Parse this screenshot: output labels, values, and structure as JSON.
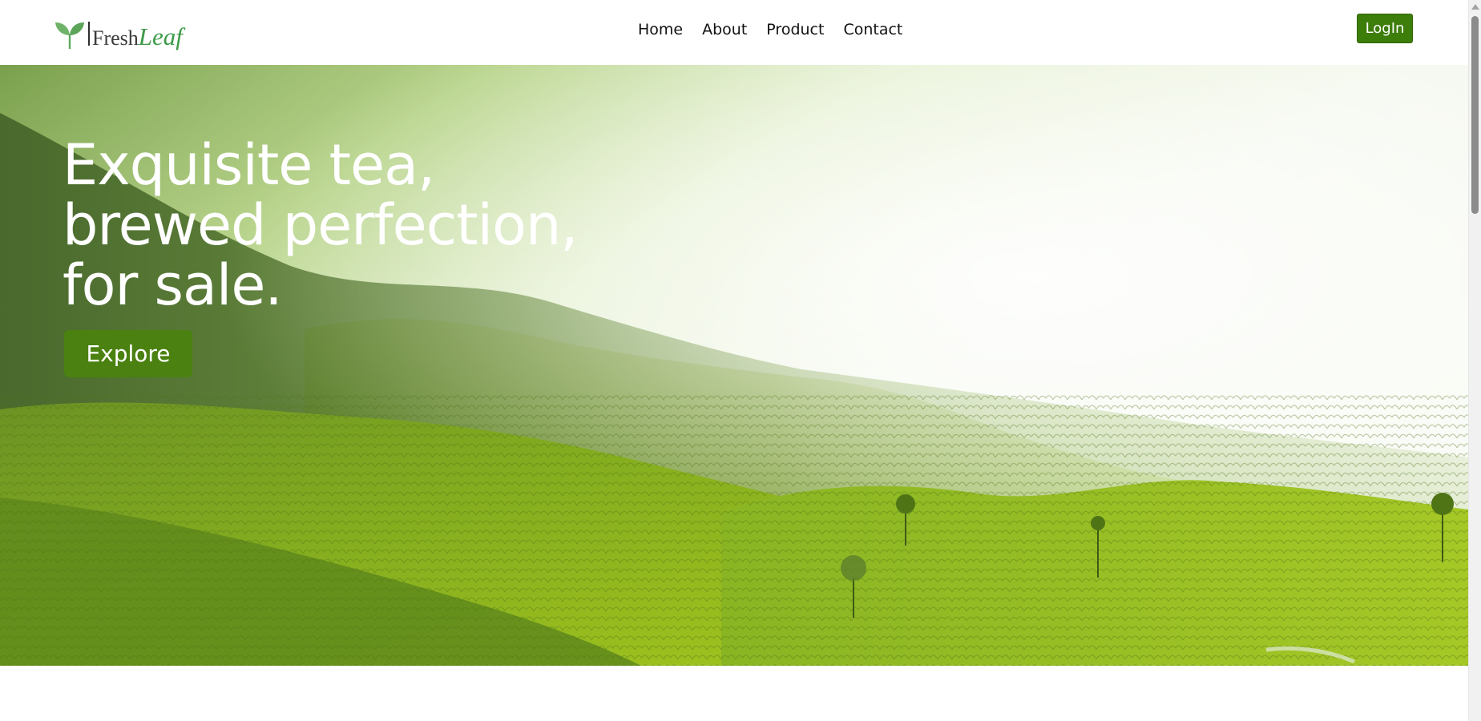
{
  "brand": {
    "name_part1": "Fresh",
    "name_part2": "Leaf",
    "icon": "sprout-leaf-icon",
    "icon_color": "#5fa85e"
  },
  "nav": {
    "links": [
      {
        "label": "Home"
      },
      {
        "label": "About"
      },
      {
        "label": "Product"
      },
      {
        "label": "Contact"
      }
    ],
    "login_label": "LogIn"
  },
  "hero": {
    "title_lines": [
      "Exquisite tea,",
      "brewed perfection,",
      "for sale."
    ],
    "cta_label": "Explore",
    "background": "misty-tea-plantation-hills"
  },
  "colors": {
    "primary_green": "#4a8110",
    "login_green": "#3d7d0a",
    "nav_text": "#111111",
    "hero_text": "#ffffff"
  }
}
